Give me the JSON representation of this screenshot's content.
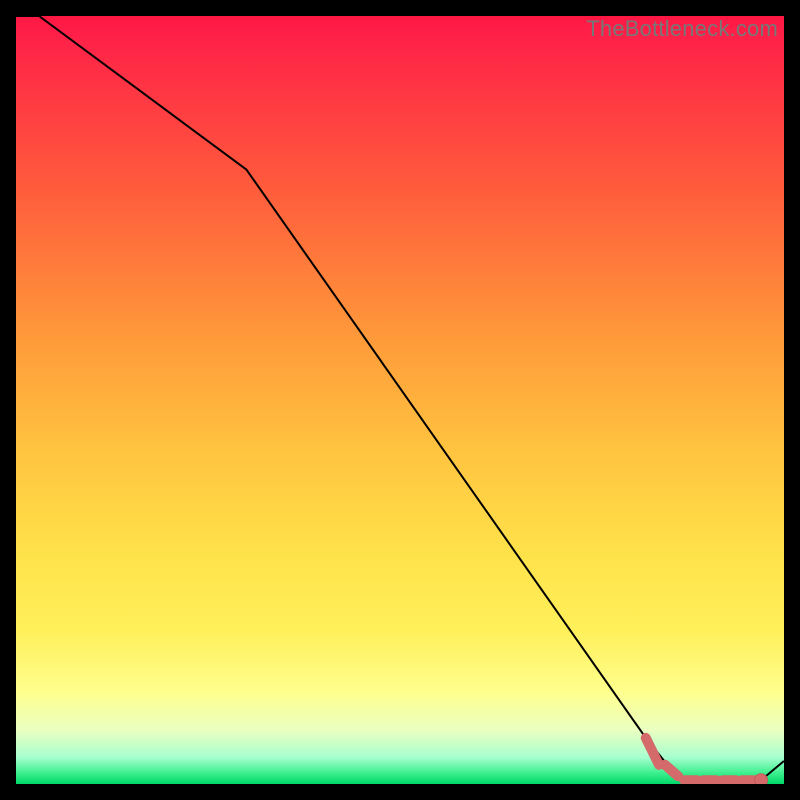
{
  "watermark": "TheBottleneck.com",
  "colors": {
    "gradient_top": "#ff1744",
    "gradient_mid_upper": "#ff6f3c",
    "gradient_mid": "#ffd23f",
    "gradient_lower": "#ffff8d",
    "gradient_bottom": "#00e676",
    "line": "#000000",
    "marker_fill": "#d46a6a",
    "marker_stroke": "#c85a5a",
    "bg": "#000000"
  },
  "chart_data": {
    "type": "line",
    "title": "",
    "xlabel": "",
    "ylabel": "",
    "xlim": [
      0,
      100
    ],
    "ylim": [
      0,
      100
    ],
    "series": [
      {
        "name": "curve",
        "x": [
          0,
          3,
          30,
          82,
          86,
          97,
          100
        ],
        "y": [
          100,
          100,
          80,
          6,
          1,
          0.5,
          3
        ]
      }
    ],
    "markers": {
      "comment": "low region dashed highlight and endpoint dot",
      "dashed_segments_x": [
        82,
        84.5,
        87,
        89.5,
        92,
        94.5,
        97
      ],
      "dashed_y": 0.5,
      "end_dot": {
        "x": 97,
        "y": 0.5
      }
    }
  }
}
